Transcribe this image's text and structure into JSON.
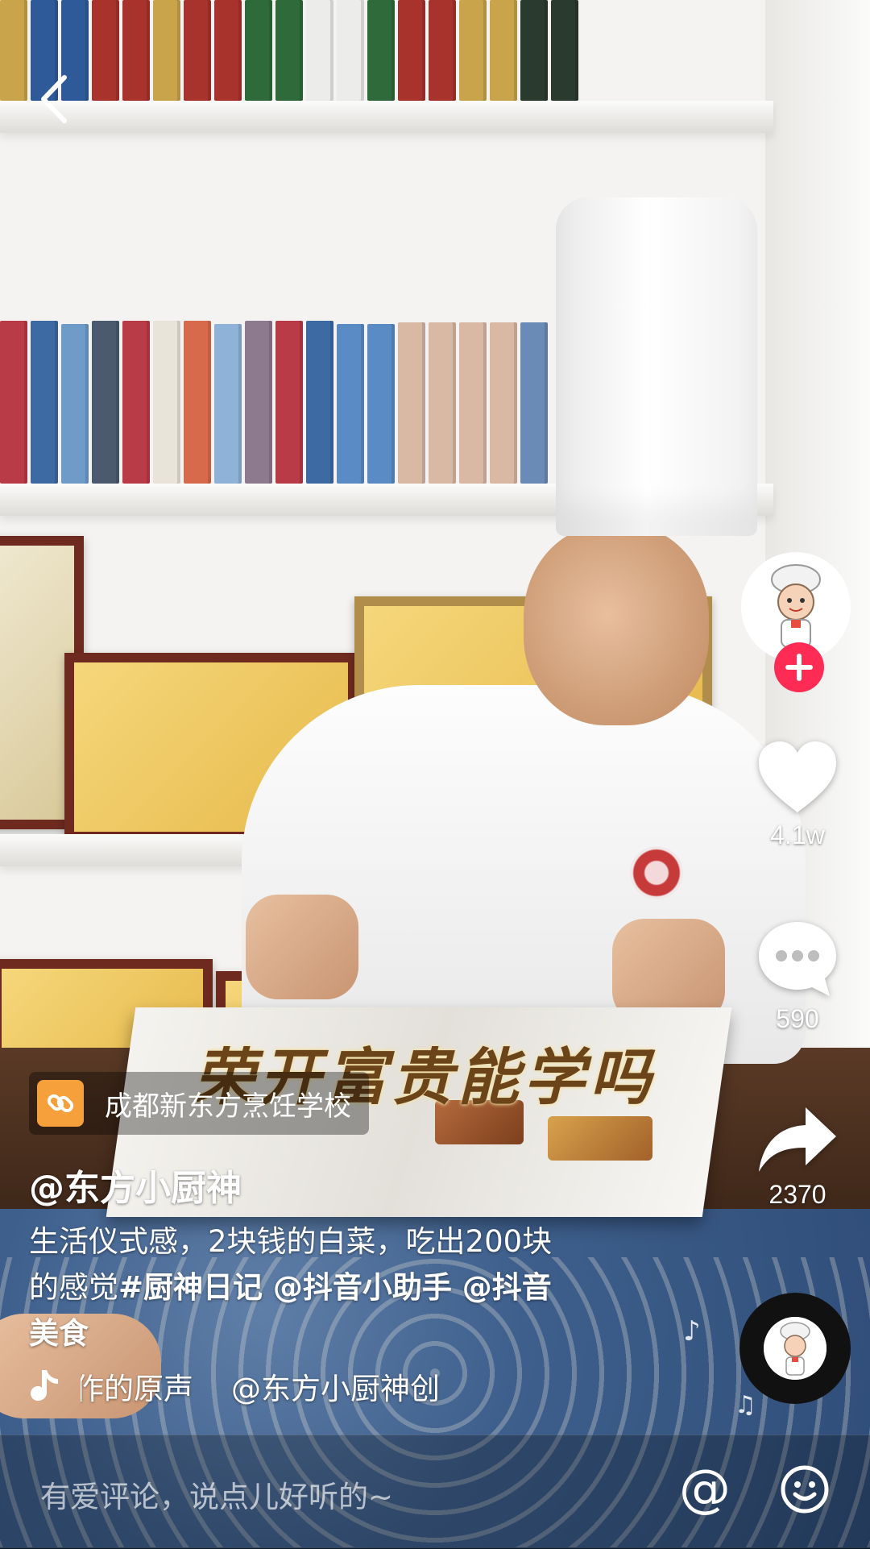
{
  "overlay_text": {
    "video_caption_art": "荣开富贵能学吗"
  },
  "poi": {
    "label": "成都新东方烹饪学校",
    "icon": "link-icon"
  },
  "author": {
    "handle": "@东方小厨神"
  },
  "description": {
    "line1": "生活仪式感，2块钱的白菜，吃出200块",
    "line2_prefix": "的感觉",
    "hashtag": "#厨神日记",
    "mention1": " @抖音小助手",
    "mention2": " @抖音",
    "line3": "美食"
  },
  "music": {
    "icon": "tiktok-note-icon",
    "marquee": "作的原声    @东方小厨神创"
  },
  "actions": {
    "like_count": "4.1w",
    "comment_count": "590",
    "share_count": "2370"
  },
  "comment_bar": {
    "placeholder": "有爱评论，说点儿好听的~",
    "at_symbol": "@"
  },
  "colors": {
    "follow_accent": "#fe2c55",
    "poi_icon_bg": "#f5a03a"
  }
}
